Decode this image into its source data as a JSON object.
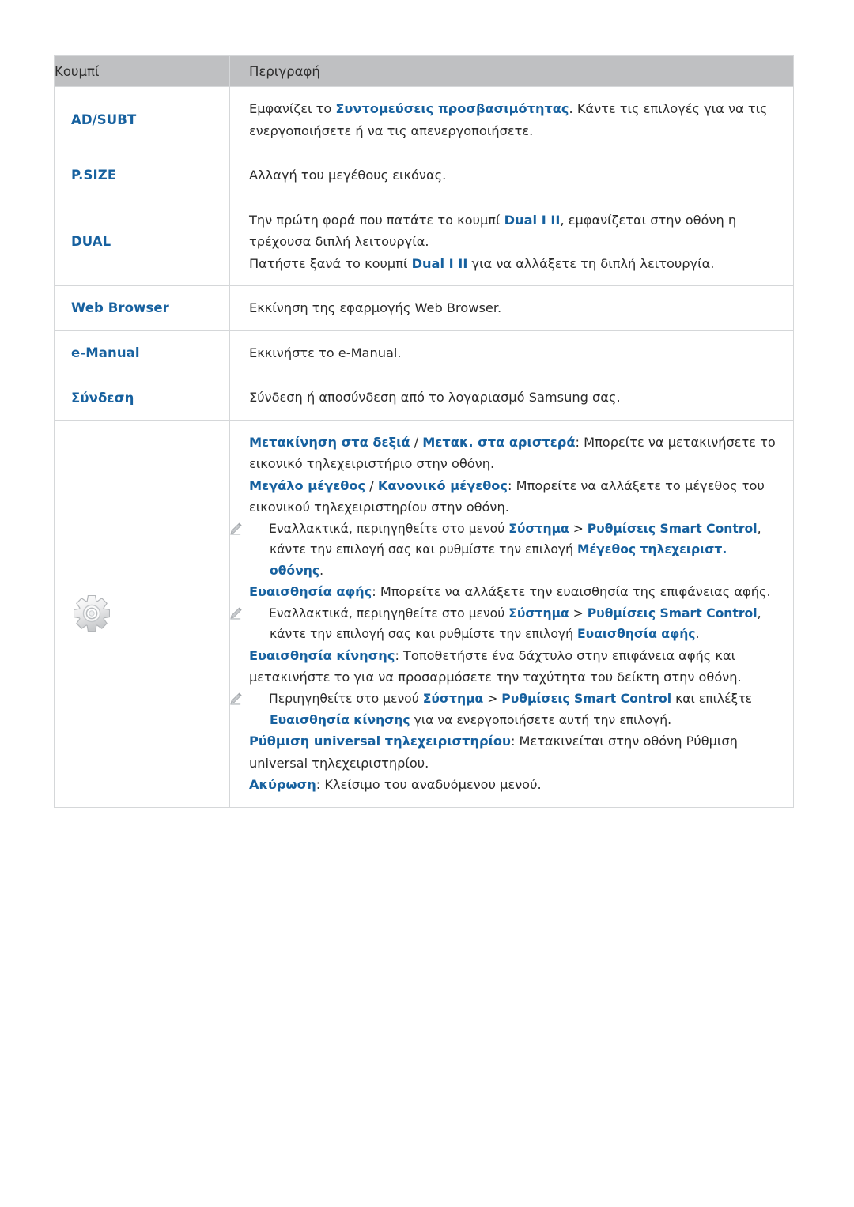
{
  "table": {
    "headers": [
      "Κουμπί",
      "Περιγραφή"
    ],
    "rows": [
      {
        "button": "AD/SUBT",
        "lines": [
          [
            {
              "t": "Εμφανίζει το ",
              "s": "plain"
            },
            {
              "t": "Συντομεύσεις προσβασιμότητας",
              "s": "b"
            },
            {
              "t": ". Κάντε τις επιλογές για να τις ενεργοποιήσετε ή να τις απενεργοποιήσετε.",
              "s": "plain"
            }
          ]
        ]
      },
      {
        "button": "P.SIZE",
        "lines": [
          [
            {
              "t": "Αλλαγή του μεγέθους εικόνας.",
              "s": "plain"
            }
          ]
        ]
      },
      {
        "button": "DUAL",
        "lines": [
          [
            {
              "t": "Την πρώτη φορά που πατάτε το κουμπί ",
              "s": "plain"
            },
            {
              "t": "Dual I II",
              "s": "b"
            },
            {
              "t": ", εμφανίζεται στην οθόνη η τρέχουσα διπλή λειτουργία.",
              "s": "plain"
            }
          ],
          [
            {
              "t": "Πατήστε ξανά το κουμπί ",
              "s": "plain"
            },
            {
              "t": "Dual I II",
              "s": "b"
            },
            {
              "t": " για να αλλάξετε τη διπλή λειτουργία.",
              "s": "plain"
            }
          ]
        ]
      },
      {
        "button": "Web Browser",
        "lines": [
          [
            {
              "t": "Εκκίνηση της εφαρμογής Web Browser.",
              "s": "plain"
            }
          ]
        ]
      },
      {
        "button": "e-Manual",
        "lines": [
          [
            {
              "t": "Εκκινήστε το e-Manual.",
              "s": "plain"
            }
          ]
        ]
      },
      {
        "button": "Σύνδεση",
        "lines": [
          [
            {
              "t": "Σύνδεση ή αποσύνδεση από το λογαριασμό Samsung σας.",
              "s": "plain"
            }
          ]
        ]
      }
    ],
    "gear_row": {
      "icon": "gear-icon",
      "blocks": [
        {
          "kind": "para",
          "runs": [
            {
              "t": "Μετακίνηση στα δεξιά",
              "s": "b"
            },
            {
              "t": " / ",
              "s": "plain"
            },
            {
              "t": "Μετακ. στα αριστερά",
              "s": "b"
            },
            {
              "t": ": Μπορείτε να μετακινήσετε το εικονικό τηλεχειριστήριο στην οθόνη.",
              "s": "plain"
            }
          ]
        },
        {
          "kind": "para",
          "runs": [
            {
              "t": "Μεγάλο μέγεθος",
              "s": "b"
            },
            {
              "t": " / ",
              "s": "plain"
            },
            {
              "t": "Κανονικό μέγεθος",
              "s": "b"
            },
            {
              "t": ": Μπορείτε να αλλάξετε το μέγεθος του εικονικού τηλεχειριστηρίου στην οθόνη.",
              "s": "plain"
            }
          ]
        },
        {
          "kind": "note",
          "runs": [
            {
              "t": "Εναλλακτικά, περιηγηθείτε στο μενού ",
              "s": "plain"
            },
            {
              "t": "Σύστημα",
              "s": "b"
            },
            {
              "t": " > ",
              "s": "plain"
            },
            {
              "t": "Ρυθμίσεις Smart Control",
              "s": "b"
            },
            {
              "t": ", κάντε την επιλογή σας και ρυθμίστε την επιλογή ",
              "s": "plain"
            },
            {
              "t": "Μέγεθος τηλεχειριστ. οθόνης",
              "s": "b"
            },
            {
              "t": ".",
              "s": "plain"
            }
          ]
        },
        {
          "kind": "para",
          "runs": [
            {
              "t": "Ευαισθησία αφής",
              "s": "b"
            },
            {
              "t": ": Μπορείτε να αλλάξετε την ευαισθησία της επιφάνειας αφής.",
              "s": "plain"
            }
          ]
        },
        {
          "kind": "note",
          "runs": [
            {
              "t": "Εναλλακτικά, περιηγηθείτε στο μενού ",
              "s": "plain"
            },
            {
              "t": "Σύστημα",
              "s": "b"
            },
            {
              "t": " > ",
              "s": "plain"
            },
            {
              "t": "Ρυθμίσεις Smart Control",
              "s": "b"
            },
            {
              "t": ", κάντε την επιλογή σας και ρυθμίστε την επιλογή ",
              "s": "plain"
            },
            {
              "t": "Ευαισθησία αφής",
              "s": "b"
            },
            {
              "t": ".",
              "s": "plain"
            }
          ]
        },
        {
          "kind": "para",
          "runs": [
            {
              "t": "Ευαισθησία κίνησης",
              "s": "b"
            },
            {
              "t": ": Τοποθετήστε ένα δάχτυλο στην επιφάνεια αφής και μετακινήστε το για να προσαρμόσετε την ταχύτητα του δείκτη στην οθόνη.",
              "s": "plain"
            }
          ]
        },
        {
          "kind": "note",
          "runs": [
            {
              "t": "Περιηγηθείτε στο μενού ",
              "s": "plain"
            },
            {
              "t": "Σύστημα",
              "s": "b"
            },
            {
              "t": " > ",
              "s": "plain"
            },
            {
              "t": "Ρυθμίσεις Smart Control",
              "s": "b"
            },
            {
              "t": " και επιλέξτε ",
              "s": "plain"
            },
            {
              "t": "Ευαισθησία κίνησης",
              "s": "b"
            },
            {
              "t": " για να ενεργοποιήσετε αυτή την επιλογή.",
              "s": "plain"
            }
          ]
        },
        {
          "kind": "para",
          "runs": [
            {
              "t": "Ρύθμιση universal τηλεχειριστηρίου",
              "s": "b"
            },
            {
              "t": ": Μετακινείται στην οθόνη Ρύθμιση universal τηλεχειριστηρίου.",
              "s": "plain"
            }
          ]
        },
        {
          "kind": "para",
          "runs": [
            {
              "t": "Ακύρωση",
              "s": "b"
            },
            {
              "t": ": Κλείσιμο του αναδυόμενου μενού.",
              "s": "plain"
            }
          ]
        }
      ]
    }
  },
  "colors": {
    "accent_blue": "#17619f",
    "header_gray": "#bfc0c2",
    "body_text": "#2b2b2b",
    "note_text": "#6e7276",
    "border": "#d5d7d9"
  }
}
